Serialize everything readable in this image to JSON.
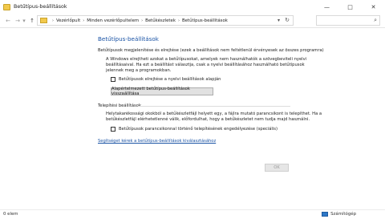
{
  "window": {
    "title": "Betűtípus-beállítások",
    "controls": {
      "minimize": "—",
      "maximize": "□",
      "close": "✕"
    }
  },
  "nav": {
    "back": "←",
    "forward": "→",
    "dropdown": "▾",
    "up": "↑"
  },
  "address": {
    "crumbs": [
      "Vezérlőpult",
      "Minden vezérlőpultelem",
      "Betűkészletek",
      "Betűtípus-beállítások"
    ],
    "separator": "›",
    "dropdown": "▾",
    "refresh": "↻",
    "folder_icon": "folder-icon"
  },
  "search": {
    "placeholder": "",
    "icon": "⌕"
  },
  "main": {
    "heading": "Betűtípus-beállítások",
    "section1": {
      "title": "Betűtípusok megjelenítése és elrejtése (ezek a beállítások nem feltétlenül érvényesek az összes programra)",
      "desc_line1": "A Windows elrejtheti azokat a betűtípusokat, amelyek nem használhatók a szövegbeviteli nyelvi",
      "desc_line2": "beállításaival. Ha ezt a beállítást választja, csak a nyelvi beállításához használható betűtípusok",
      "desc_line3": "jelennek meg a programokban.",
      "checkbox_label": "Betűtípusok elrejtése a nyelvi beállítások alapján",
      "checkbox_checked": false,
      "restore_button": "Alapértelmezett betűtípus-beállítások visszaállítása"
    },
    "section2": {
      "title": "Telepítési beállítások",
      "desc_line1": "Helytakarékossági okokból a betűkészletfájl helyett egy, a fájlra mutató parancsikont is telepíthet. Ha a",
      "desc_line2": "betűkészletfájl elérhetetlenné válik, előfordulhat, hogy a betűkészletet nem tudja majd használni.",
      "checkbox_label": "Betűtípusok parancsikonnal történő telepítésének engedélyezése (speciális)",
      "checkbox_checked": false
    },
    "help_link": "Segítséget kérek a betűtípus-beállítások kiválasztásához",
    "ok_button": "OK"
  },
  "status": {
    "items": "0 elem",
    "location": "Számítógép"
  }
}
